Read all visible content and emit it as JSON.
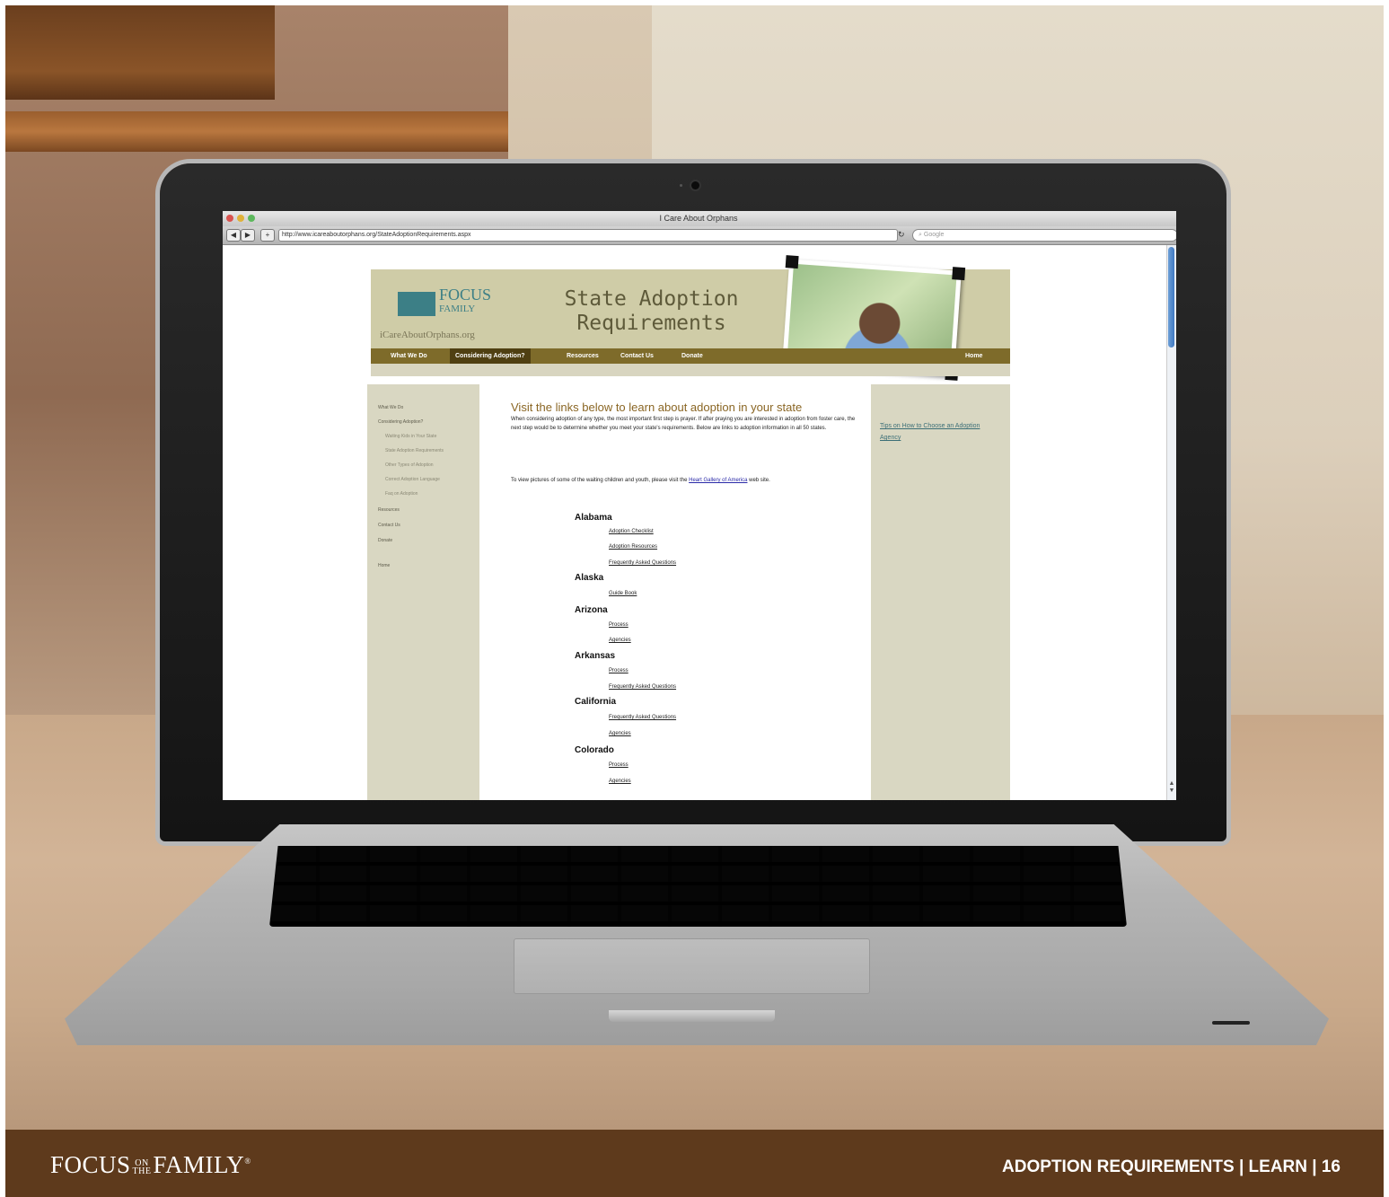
{
  "browser": {
    "window_title": "I Care About Orphans",
    "url": "http://www.icareaboutorphans.org/StateAdoptionRequirements.aspx",
    "search_placeholder": "Google"
  },
  "site": {
    "logo_line1": "FOCUS",
    "logo_line2": "FAMILY",
    "logo_url": "iCareAboutOrphans.org",
    "headline_line1": "State Adoption",
    "headline_line2": "Requirements",
    "nav": [
      "What We Do",
      "Considering Adoption?",
      "Resources",
      "Contact Us",
      "Donate"
    ],
    "nav_home": "Home",
    "left_nav": [
      {
        "label": "What We Do",
        "sub": false
      },
      {
        "label": "Considering Adoption?",
        "sub": false
      },
      {
        "label": "Waiting Kids in Your State",
        "sub": true
      },
      {
        "label": "State Adoption Requirements",
        "sub": true
      },
      {
        "label": "Other Types of Adoption",
        "sub": true
      },
      {
        "label": "Correct Adoption Language",
        "sub": true
      },
      {
        "label": "Faq on Adoption",
        "sub": true
      },
      {
        "label": "Resources",
        "sub": false
      },
      {
        "label": "Contact Us",
        "sub": false
      },
      {
        "label": "Donate",
        "sub": false
      },
      {
        "label": "Home",
        "sub": false
      }
    ],
    "main_title": "Visit the links below to learn about adoption in your state",
    "intro": "When considering adoption of any type, the most important first step is prayer. If after praying you are interested in adoption from foster care, the next step would be to determine whether you meet your state's requirements. Below are links to adoption information in all 50 states.",
    "intro2_prefix": "To view pictures of some of the waiting children and youth, please visit the ",
    "intro2_link": "Heart Gallery of America",
    "intro2_suffix": " web site.",
    "states": [
      {
        "name": "Alabama",
        "links": [
          "Adoption Checklist",
          "Adoption Resources",
          "Frequently Asked Questions"
        ]
      },
      {
        "name": "Alaska",
        "links": [
          "Guide Book"
        ]
      },
      {
        "name": "Arizona",
        "links": [
          "Process",
          "Agencies"
        ]
      },
      {
        "name": "Arkansas",
        "links": [
          "Process",
          "Frequently Asked Questions"
        ]
      },
      {
        "name": "California",
        "links": [
          "Frequently Asked Questions",
          "Agencies"
        ]
      },
      {
        "name": "Colorado",
        "links": [
          "Process",
          "Agencies"
        ]
      }
    ],
    "right_link": "Tips on How to Choose an Adoption Agency"
  },
  "footer": {
    "logo_left": "FOCUS",
    "logo_on": "ON",
    "logo_the": "THE",
    "logo_right": "FAMILY",
    "right_text": "ADOPTION REQUIREMENTS  |  LEARN  |  16"
  }
}
